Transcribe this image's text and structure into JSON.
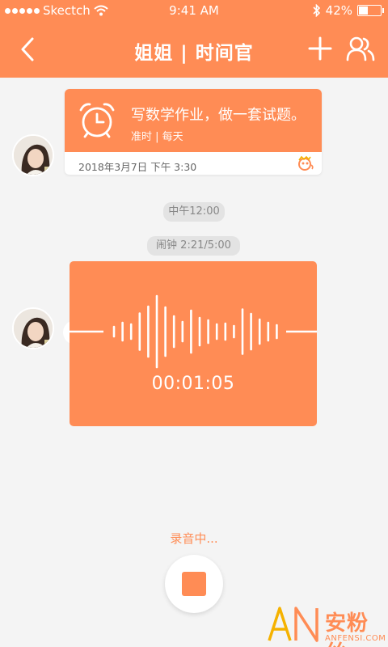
{
  "status_bar": {
    "carrier": "Skectch",
    "time": "9:41 AM",
    "battery_percent": "42%",
    "battery_level": 0.42,
    "icons": [
      "signal-dots-icon",
      "wifi-icon",
      "bluetooth-icon",
      "battery-icon"
    ]
  },
  "navbar": {
    "title": "姐姐 | 时间官",
    "back_icon": "chevron-left-icon",
    "add_icon": "plus-icon",
    "members_icon": "users-icon"
  },
  "reminder_card": {
    "task": "写数学作业，做一套试题。",
    "repeat": "准时 | 每天",
    "datetime": "2018年3月7日 下午 3:30",
    "icon": "alarm-clock-icon"
  },
  "timeline": {
    "time_pill": "中午12:00",
    "alarm_pill": "闹钟 2:21/5:00"
  },
  "voice_card": {
    "duration": "00:01:05",
    "waveform_bars": [
      12,
      22,
      18,
      45,
      62,
      88,
      60,
      38,
      24,
      52,
      34,
      28,
      18,
      20,
      14,
      55,
      44,
      30,
      22,
      16
    ]
  },
  "recording": {
    "status_label": "录音中...",
    "stop_icon": "stop-icon"
  },
  "watermark": {
    "logo_text": "AN",
    "cn_text": "安粉丝",
    "en_text": "ANFENSI.COM"
  },
  "colors": {
    "accent": "#ff8c55",
    "background": "#f4f4f4",
    "pill_bg": "#e3e3e3"
  }
}
